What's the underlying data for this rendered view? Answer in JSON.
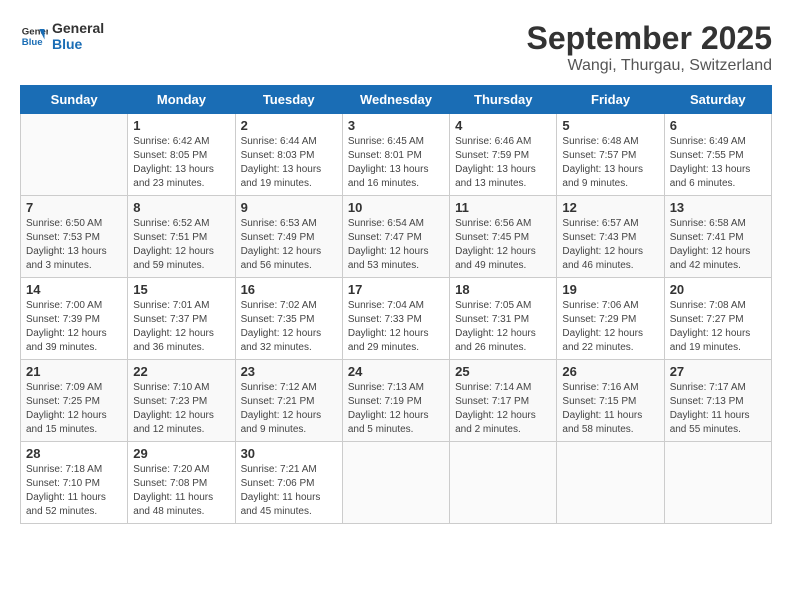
{
  "header": {
    "logo_line1": "General",
    "logo_line2": "Blue",
    "month": "September 2025",
    "location": "Wangi, Thurgau, Switzerland"
  },
  "weekdays": [
    "Sunday",
    "Monday",
    "Tuesday",
    "Wednesday",
    "Thursday",
    "Friday",
    "Saturday"
  ],
  "weeks": [
    [
      {
        "day": "",
        "info": ""
      },
      {
        "day": "1",
        "info": "Sunrise: 6:42 AM\nSunset: 8:05 PM\nDaylight: 13 hours\nand 23 minutes."
      },
      {
        "day": "2",
        "info": "Sunrise: 6:44 AM\nSunset: 8:03 PM\nDaylight: 13 hours\nand 19 minutes."
      },
      {
        "day": "3",
        "info": "Sunrise: 6:45 AM\nSunset: 8:01 PM\nDaylight: 13 hours\nand 16 minutes."
      },
      {
        "day": "4",
        "info": "Sunrise: 6:46 AM\nSunset: 7:59 PM\nDaylight: 13 hours\nand 13 minutes."
      },
      {
        "day": "5",
        "info": "Sunrise: 6:48 AM\nSunset: 7:57 PM\nDaylight: 13 hours\nand 9 minutes."
      },
      {
        "day": "6",
        "info": "Sunrise: 6:49 AM\nSunset: 7:55 PM\nDaylight: 13 hours\nand 6 minutes."
      }
    ],
    [
      {
        "day": "7",
        "info": "Sunrise: 6:50 AM\nSunset: 7:53 PM\nDaylight: 13 hours\nand 3 minutes."
      },
      {
        "day": "8",
        "info": "Sunrise: 6:52 AM\nSunset: 7:51 PM\nDaylight: 12 hours\nand 59 minutes."
      },
      {
        "day": "9",
        "info": "Sunrise: 6:53 AM\nSunset: 7:49 PM\nDaylight: 12 hours\nand 56 minutes."
      },
      {
        "day": "10",
        "info": "Sunrise: 6:54 AM\nSunset: 7:47 PM\nDaylight: 12 hours\nand 53 minutes."
      },
      {
        "day": "11",
        "info": "Sunrise: 6:56 AM\nSunset: 7:45 PM\nDaylight: 12 hours\nand 49 minutes."
      },
      {
        "day": "12",
        "info": "Sunrise: 6:57 AM\nSunset: 7:43 PM\nDaylight: 12 hours\nand 46 minutes."
      },
      {
        "day": "13",
        "info": "Sunrise: 6:58 AM\nSunset: 7:41 PM\nDaylight: 12 hours\nand 42 minutes."
      }
    ],
    [
      {
        "day": "14",
        "info": "Sunrise: 7:00 AM\nSunset: 7:39 PM\nDaylight: 12 hours\nand 39 minutes."
      },
      {
        "day": "15",
        "info": "Sunrise: 7:01 AM\nSunset: 7:37 PM\nDaylight: 12 hours\nand 36 minutes."
      },
      {
        "day": "16",
        "info": "Sunrise: 7:02 AM\nSunset: 7:35 PM\nDaylight: 12 hours\nand 32 minutes."
      },
      {
        "day": "17",
        "info": "Sunrise: 7:04 AM\nSunset: 7:33 PM\nDaylight: 12 hours\nand 29 minutes."
      },
      {
        "day": "18",
        "info": "Sunrise: 7:05 AM\nSunset: 7:31 PM\nDaylight: 12 hours\nand 26 minutes."
      },
      {
        "day": "19",
        "info": "Sunrise: 7:06 AM\nSunset: 7:29 PM\nDaylight: 12 hours\nand 22 minutes."
      },
      {
        "day": "20",
        "info": "Sunrise: 7:08 AM\nSunset: 7:27 PM\nDaylight: 12 hours\nand 19 minutes."
      }
    ],
    [
      {
        "day": "21",
        "info": "Sunrise: 7:09 AM\nSunset: 7:25 PM\nDaylight: 12 hours\nand 15 minutes."
      },
      {
        "day": "22",
        "info": "Sunrise: 7:10 AM\nSunset: 7:23 PM\nDaylight: 12 hours\nand 12 minutes."
      },
      {
        "day": "23",
        "info": "Sunrise: 7:12 AM\nSunset: 7:21 PM\nDaylight: 12 hours\nand 9 minutes."
      },
      {
        "day": "24",
        "info": "Sunrise: 7:13 AM\nSunset: 7:19 PM\nDaylight: 12 hours\nand 5 minutes."
      },
      {
        "day": "25",
        "info": "Sunrise: 7:14 AM\nSunset: 7:17 PM\nDaylight: 12 hours\nand 2 minutes."
      },
      {
        "day": "26",
        "info": "Sunrise: 7:16 AM\nSunset: 7:15 PM\nDaylight: 11 hours\nand 58 minutes."
      },
      {
        "day": "27",
        "info": "Sunrise: 7:17 AM\nSunset: 7:13 PM\nDaylight: 11 hours\nand 55 minutes."
      }
    ],
    [
      {
        "day": "28",
        "info": "Sunrise: 7:18 AM\nSunset: 7:10 PM\nDaylight: 11 hours\nand 52 minutes."
      },
      {
        "day": "29",
        "info": "Sunrise: 7:20 AM\nSunset: 7:08 PM\nDaylight: 11 hours\nand 48 minutes."
      },
      {
        "day": "30",
        "info": "Sunrise: 7:21 AM\nSunset: 7:06 PM\nDaylight: 11 hours\nand 45 minutes."
      },
      {
        "day": "",
        "info": ""
      },
      {
        "day": "",
        "info": ""
      },
      {
        "day": "",
        "info": ""
      },
      {
        "day": "",
        "info": ""
      }
    ]
  ]
}
